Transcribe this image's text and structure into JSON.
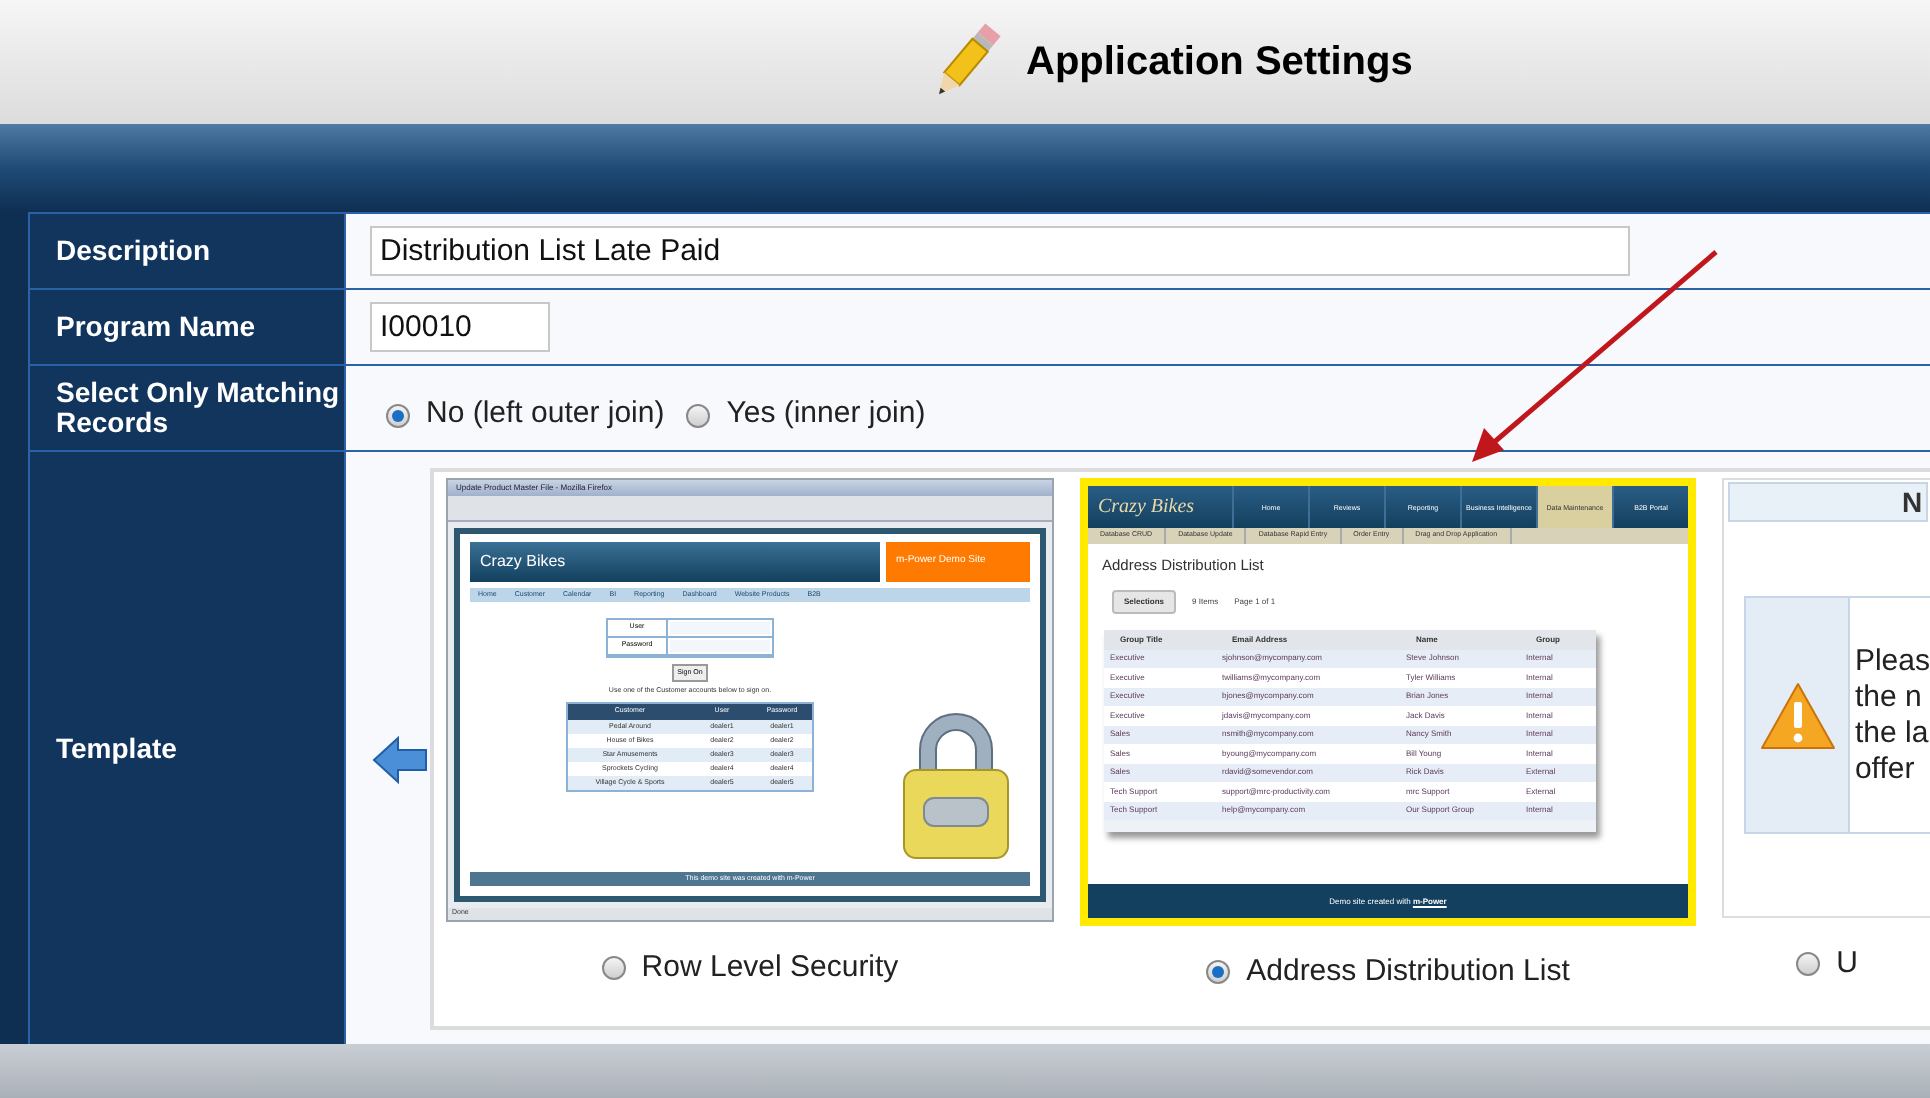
{
  "header": {
    "title": "Application Settings"
  },
  "form": {
    "rows": [
      {
        "kind": "text",
        "label": "Description",
        "value": "Distribution List Late Paid"
      },
      {
        "kind": "code",
        "label": "Program Name",
        "value": "I00010"
      },
      {
        "kind": "radio",
        "label": "Select Only Matching Records",
        "options": [
          {
            "label": "No (left outer join)",
            "selected": true
          },
          {
            "label": "Yes (inner join)",
            "selected": false
          }
        ]
      },
      {
        "kind": "template",
        "label": "Template",
        "templates": [
          {
            "label": "Row Level Security",
            "selected": false,
            "preview": {
              "kind": "login",
              "window_title": "Update Product Master File - Mozilla Firefox",
              "logo": "Crazy Bikes",
              "badge": "m-Power Demo Site",
              "nav": [
                "Home",
                "Customer",
                "Calendar",
                "BI",
                "Reporting",
                "Dashboard",
                "Website Products",
                "B2B"
              ],
              "fields": [
                "User",
                "Password"
              ],
              "button": "Sign On",
              "hint": "Use one of the Customer accounts below to sign on.",
              "columns": [
                "Customer",
                "User",
                "Password"
              ],
              "rows": [
                [
                  "Pedal Around",
                  "dealer1",
                  "dealer1"
                ],
                [
                  "House of Bikes",
                  "dealer2",
                  "dealer2"
                ],
                [
                  "Star Amusements",
                  "dealer3",
                  "dealer3"
                ],
                [
                  "Sprockets Cycling",
                  "dealer4",
                  "dealer4"
                ],
                [
                  "Village Cycle & Sports",
                  "dealer5",
                  "dealer5"
                ]
              ],
              "footer": "This demo site was created with m-Power",
              "status": "Done"
            }
          },
          {
            "label": "Address Distribution List",
            "selected": true,
            "preview": {
              "kind": "list",
              "logo": "Crazy Bikes",
              "nav": [
                {
                  "label": "Home",
                  "selected": false
                },
                {
                  "label": "Reviews",
                  "selected": false
                },
                {
                  "label": "Reporting",
                  "selected": false
                },
                {
                  "label": "Business Intelligence",
                  "selected": false
                },
                {
                  "label": "Data Maintenance",
                  "selected": true
                },
                {
                  "label": "B2B Portal",
                  "selected": false
                }
              ],
              "subnav": [
                "Database CRUD",
                "Database Update",
                "Database Rapid Entry",
                "Order Entry",
                "Drag and Drop Application"
              ],
              "title": "Address Distribution List",
              "button": "Selections",
              "count": "9 Items",
              "page": "Page 1 of 1",
              "columns": [
                "Group Title",
                "Email Address",
                "Name",
                "Group"
              ],
              "rows": [
                [
                  "Executive",
                  "sjohnson@mycompany.com",
                  "Steve Johnson",
                  "Internal"
                ],
                [
                  "Executive",
                  "twilliams@mycompany.com",
                  "Tyler Williams",
                  "Internal"
                ],
                [
                  "Executive",
                  "bjones@mycompany.com",
                  "Brian Jones",
                  "Internal"
                ],
                [
                  "Executive",
                  "jdavis@mycompany.com",
                  "Jack Davis",
                  "Internal"
                ],
                [
                  "Sales",
                  "nsmith@mycompany.com",
                  "Nancy Smith",
                  "Internal"
                ],
                [
                  "Sales",
                  "byoung@mycompany.com",
                  "Bill Young",
                  "Internal"
                ],
                [
                  "Sales",
                  "rdavid@somevendor.com",
                  "Rick Davis",
                  "External"
                ],
                [
                  "Tech Support",
                  "support@mrc-productivity.com",
                  "mrc Support",
                  "External"
                ],
                [
                  "Tech Support",
                  "help@mycompany.com",
                  "Our Support Group",
                  "Internal"
                ]
              ],
              "footer": "Demo site created with ",
              "footer_link": "m-Power"
            }
          },
          {
            "label": "U",
            "selected": false,
            "preview": {
              "kind": "notice",
              "heading": "N",
              "lines": [
                "Pleas",
                "the n",
                "the la",
                "offer"
              ]
            }
          }
        ]
      }
    ]
  }
}
